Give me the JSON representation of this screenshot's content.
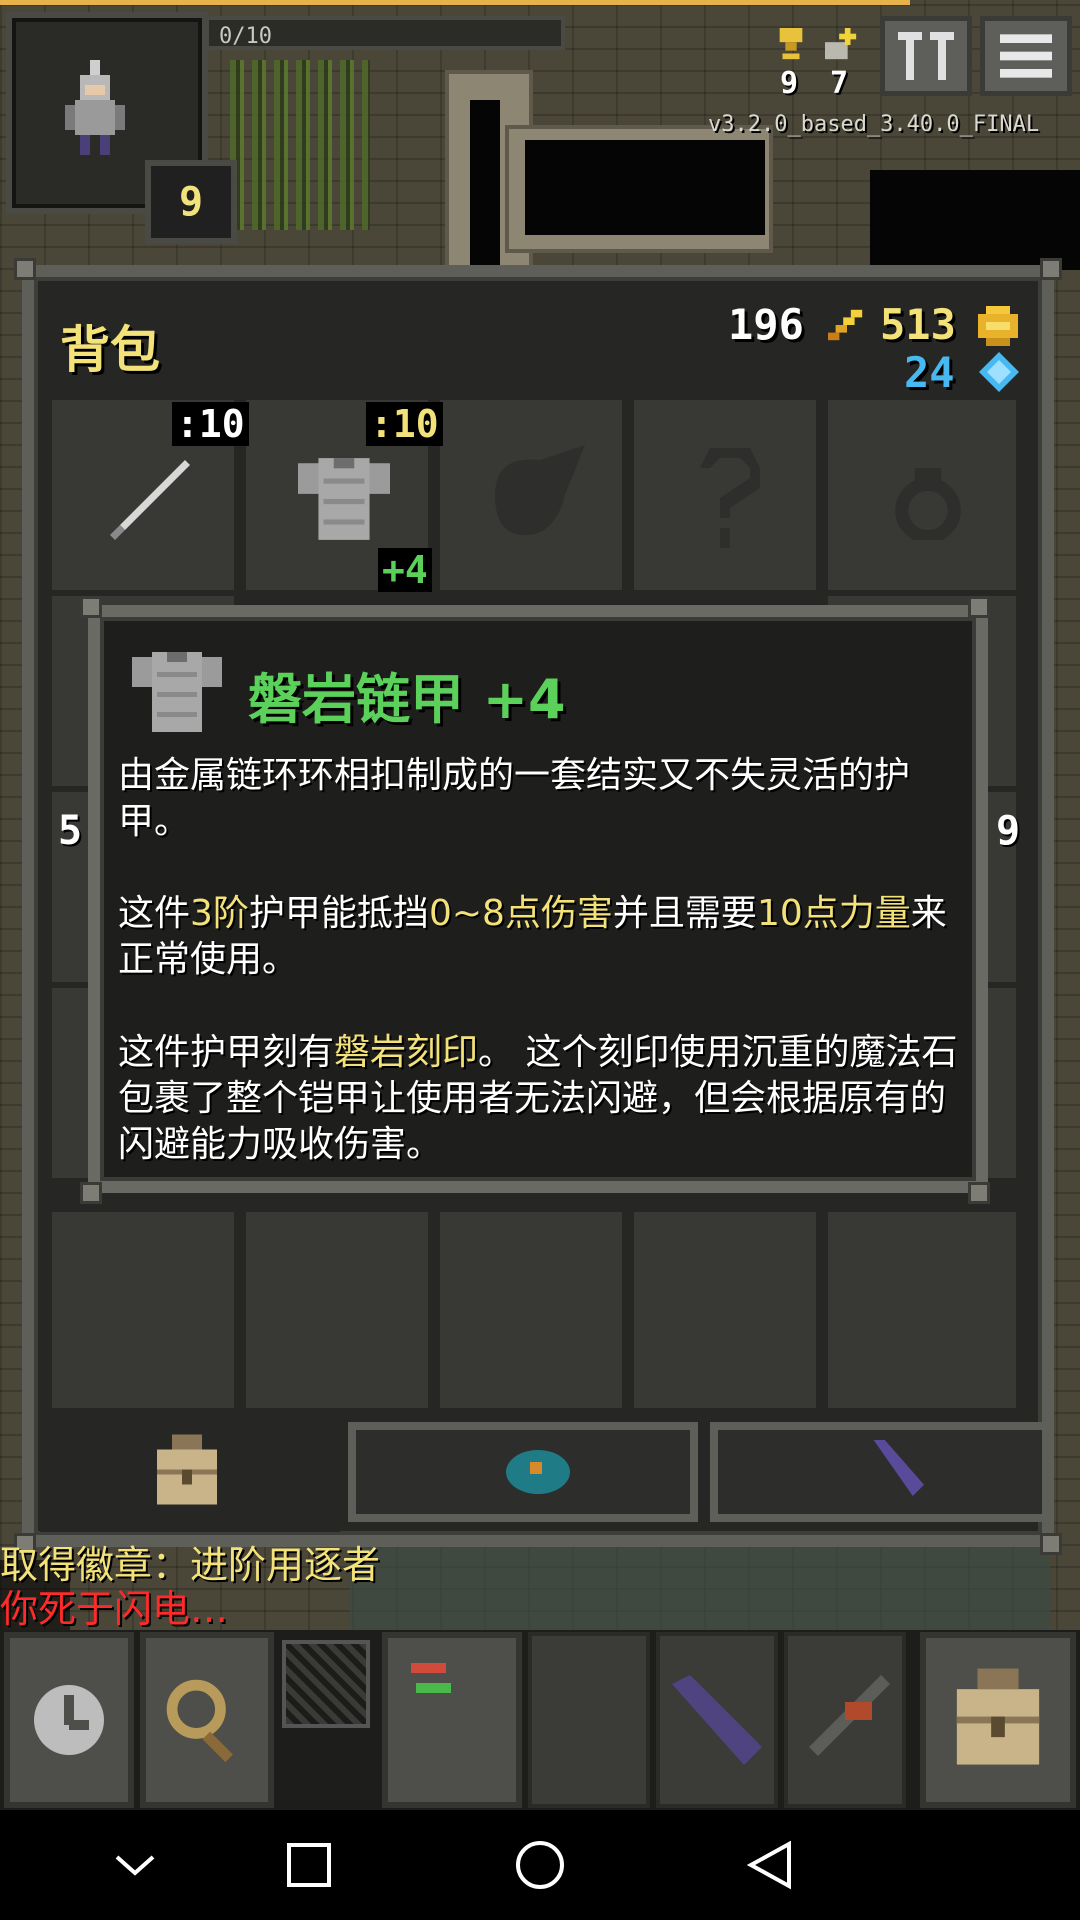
{
  "hud": {
    "xp_text": "0/10",
    "level": "9",
    "challenges_count": "9",
    "keys_count": "7",
    "version": "v3.2.0_based_3.40.0_FINAL"
  },
  "backpack": {
    "title": "背包",
    "gold": "196",
    "energy": "513",
    "gems": "24",
    "weapon_slot_label": ":10",
    "armor_slot_label": ":10",
    "armor_upgrade": "+4",
    "side_left": "5",
    "side_right": "9"
  },
  "item_info": {
    "name": "磐岩链甲 +4",
    "p1": "由金属链环环相扣制成的一套结实又不失灵活的护甲。",
    "p2_a": "这件",
    "p2_tier": "3阶",
    "p2_b": "护甲能抵挡",
    "p2_dmg": "0~8点伤害",
    "p2_c": "并且需要",
    "p2_str": "10点力量",
    "p2_d": "来正常使用。",
    "p3_a": "这件护甲刻有",
    "p3_glyph": "磐岩刻印",
    "p3_b": "。 这个刻印使用沉重的魔法石包裹了整个铠甲让使用者无法闪避，但会根据原有的闪避能力吸收伤害。"
  },
  "log": {
    "line1": "取得徽章：进阶用逐者",
    "line2": "你死于闪电…"
  },
  "colors": {
    "accent_yellow": "#f3e27a",
    "item_green": "#5bd15b",
    "gem_blue": "#48b9f0",
    "log_red": "#ff2a2a"
  },
  "icons": [
    "hero-portrait",
    "trophy-icon",
    "key-icon",
    "journal-icon",
    "menu-icon",
    "gold-icon",
    "energy-icon",
    "gem-icon",
    "sword-icon",
    "chainmail-icon",
    "backpack-icon",
    "wait-icon",
    "search-icon",
    "swap-icon"
  ]
}
